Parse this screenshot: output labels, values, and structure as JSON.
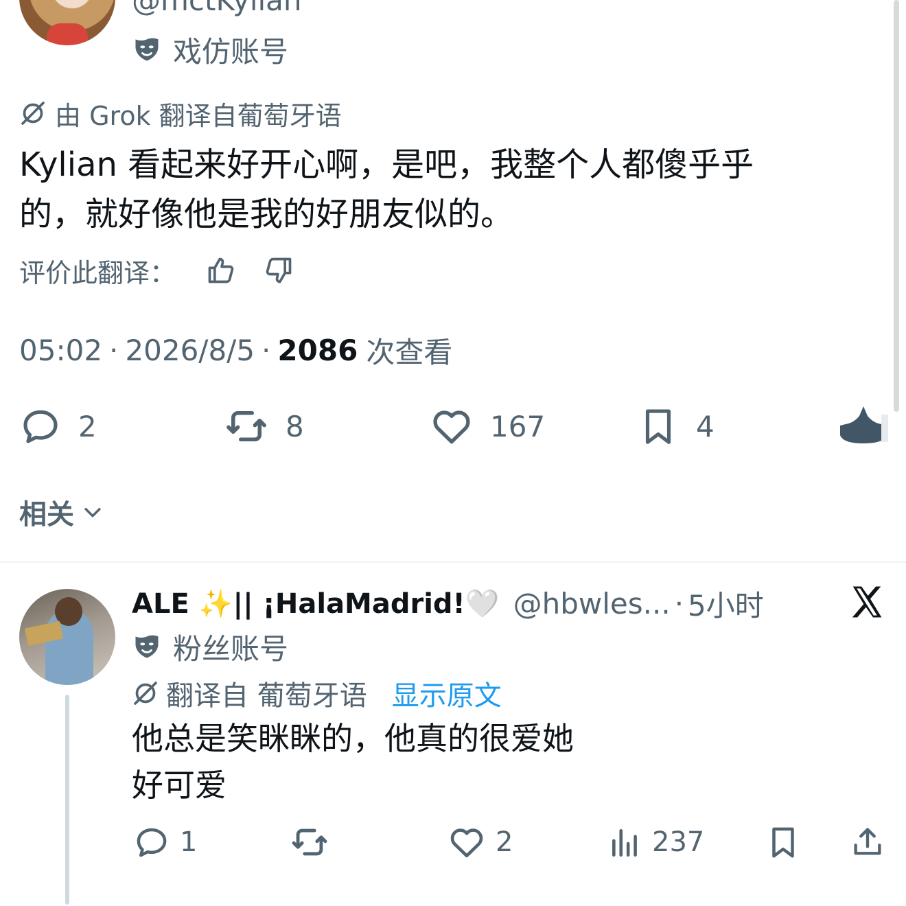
{
  "main_tweet": {
    "handle": "@mctKylian",
    "account_label": "戏仿账号",
    "translation_notice": "由 Grok 翻译自葡萄牙语",
    "text_line1": "Kylian 看起来好开心啊，是吧，我整个人都傻乎乎",
    "text_line2": "的，就好像他是我的好朋友似的。",
    "rate_label": "评价此翻译：",
    "time": "05:02",
    "date": "2026/8/5",
    "views_count": "2086",
    "views_label": "次查看",
    "separator": "·",
    "actions": {
      "replies": "2",
      "reposts": "8",
      "likes": "167",
      "bookmarks": "4"
    }
  },
  "related": {
    "label": "相关"
  },
  "reply_tweet": {
    "name": "ALE ✨|| ¡HalaMadrid!🤍",
    "handle": "@hbwles...",
    "separator": "·",
    "time": "5小时",
    "account_label": "粉丝账号",
    "translation_notice": "翻译自 葡萄牙语",
    "show_original": "显示原文",
    "text_line1": "他总是笑眯眯的，他真的很爱她",
    "text_line2": "好可爱",
    "actions": {
      "replies": "1",
      "likes": "2",
      "views": "237"
    }
  },
  "icons": {
    "account_label_icon": "mask-icon",
    "translate_icon": "translate-slash-icon",
    "thumbs_up": "thumbs-up-icon",
    "thumbs_down": "thumbs-down-icon",
    "reply": "reply-icon",
    "repost": "repost-icon",
    "like": "heart-icon",
    "bookmark": "bookmark-icon",
    "views": "views-icon",
    "share": "share-icon",
    "platform": "x-logo-icon"
  },
  "colors": {
    "text": "#0f1419",
    "muted": "#536471",
    "link": "#1d9bf0",
    "divider": "#eff3f4",
    "thread_line": "#cfd9de"
  }
}
